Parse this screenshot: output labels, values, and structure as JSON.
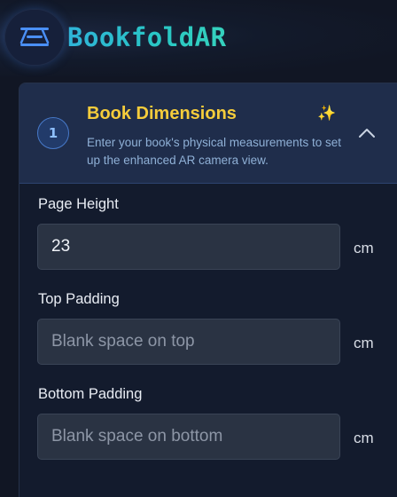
{
  "app": {
    "title": "BookfoldAR",
    "menu_icon": "menu-icon"
  },
  "step": {
    "number": "1",
    "title": "Book Dimensions",
    "sparkle_icon": "sparkle-icon",
    "description": "Enter your book's physical measurements to set up the enhanced AR camera view.",
    "expanded": true
  },
  "fields": [
    {
      "label": "Page Height",
      "value": "23",
      "placeholder": "",
      "unit": "cm"
    },
    {
      "label": "Top Padding",
      "value": "",
      "placeholder": "Blank space on top",
      "unit": "cm"
    },
    {
      "label": "Bottom Padding",
      "value": "",
      "placeholder": "Blank space on bottom",
      "unit": "cm"
    }
  ],
  "colors": {
    "background": "#111624",
    "title_gradient_start": "#2fb4d8",
    "title_gradient_end": "#36d2bd",
    "step_title": "#f5cc3b",
    "description": "#8fb0d6",
    "input_bg": "#2a3343"
  }
}
